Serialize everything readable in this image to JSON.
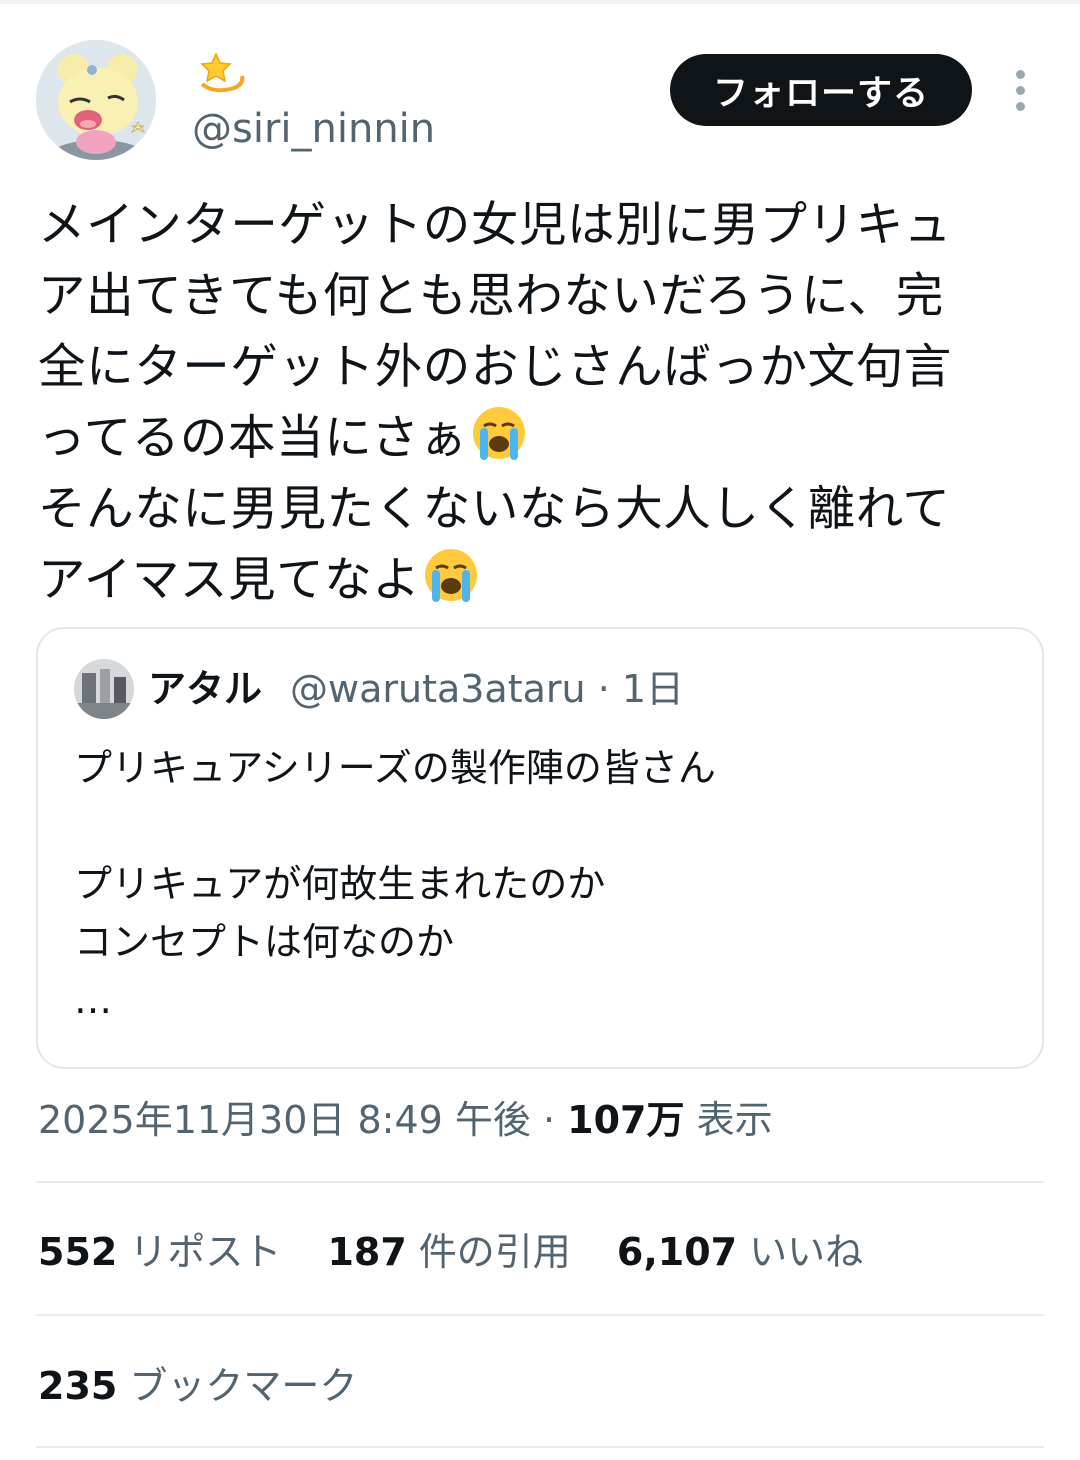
{
  "author": {
    "handle": "@siri_ninnin",
    "display_name_icon": "dizzy-star-emoji",
    "avatar_icon": "yellow-bear-character-avatar"
  },
  "actions": {
    "follow_label": "フォローする",
    "more_icon": "vertical-ellipsis-icon"
  },
  "tweet": {
    "lines": [
      "メインターゲットの女児は別に男プリキュ",
      "ア出てきても何とも思わないだろうに、完",
      "全にターゲット外のおじさんばっか文句言",
      "ってるの本当にさぁ",
      "そんなに男見たくないなら大人しく離れて",
      "アイマス見てなよ"
    ],
    "emoji": "loudly-crying-face-emoji"
  },
  "quote": {
    "name": "アタル",
    "meta": "@waruta3ataru · 1日",
    "lines": [
      "プリキュアシリーズの製作陣の皆さん",
      "",
      "プリキュアが何故生まれたのか",
      "コンセプトは何なのか",
      "…"
    ]
  },
  "timestamp": {
    "datetime": "2025年11月30日 8:49 午後 · ",
    "views_count": "107万",
    "views_label": " 表示"
  },
  "stats": {
    "reposts_count": "552",
    "reposts_label": "リポスト",
    "quotes_count": "187",
    "quotes_label": "件の引用",
    "likes_count": "6,107",
    "likes_label": "いいね",
    "bookmarks_count": "235",
    "bookmarks_label": "ブックマーク"
  },
  "colors": {
    "text_primary": "#0f1419",
    "text_secondary": "#536471",
    "border": "#e1e8ed",
    "button_bg": "#0f1419"
  }
}
